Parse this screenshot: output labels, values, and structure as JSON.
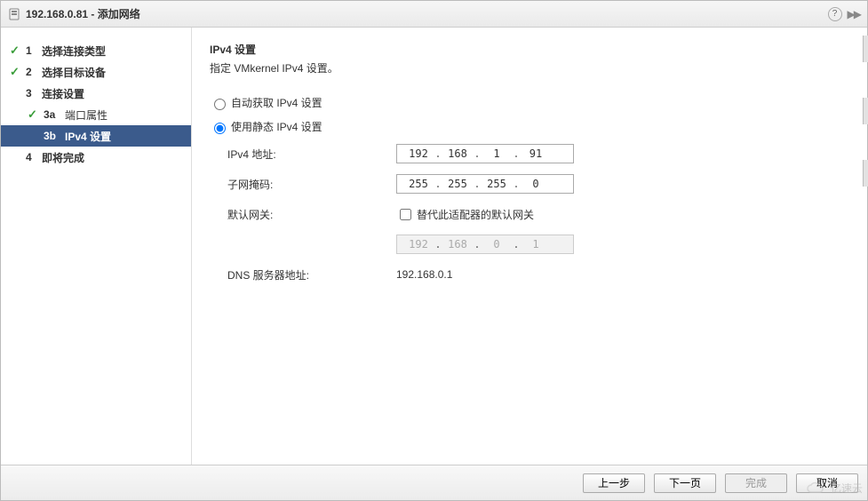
{
  "title": "192.168.0.81 - 添加网络",
  "steps": [
    {
      "num": "1",
      "label": "选择连接类型",
      "done": true,
      "bold": true
    },
    {
      "num": "2",
      "label": "选择目标设备",
      "done": true,
      "bold": true
    },
    {
      "num": "3",
      "label": "连接设置",
      "done": false,
      "bold": true
    },
    {
      "num": "3a",
      "label": "端口属性",
      "done": true,
      "bold": false,
      "sub": true
    },
    {
      "num": "3b",
      "label": "IPv4 设置",
      "done": false,
      "bold": true,
      "sub": true,
      "selected": true
    },
    {
      "num": "4",
      "label": "即将完成",
      "done": false,
      "bold": true
    }
  ],
  "section": {
    "title": "IPv4 设置",
    "subtitle": "指定 VMkernel IPv4 设置。"
  },
  "radios": {
    "auto": "自动获取 IPv4 设置",
    "static": "使用静态 IPv4 设置",
    "selected": "static"
  },
  "form": {
    "ip_label": "IPv4 地址:",
    "mask_label": "子网掩码:",
    "gw_label": "默认网关:",
    "override_gw_label": "替代此适配器的默认网关",
    "dns_label": "DNS 服务器地址:",
    "ip": {
      "o1": "192",
      "o2": "168",
      "o3": "1",
      "o4": "91"
    },
    "mask": {
      "o1": "255",
      "o2": "255",
      "o3": "255",
      "o4": "0"
    },
    "gw": {
      "o1": "192",
      "o2": "168",
      "o3": "0",
      "o4": "1"
    },
    "override_gw_checked": false,
    "dns_value": "192.168.0.1"
  },
  "buttons": {
    "back": "上一步",
    "next": "下一页",
    "finish": "完成",
    "cancel": "取消"
  },
  "watermark": "亿速云"
}
